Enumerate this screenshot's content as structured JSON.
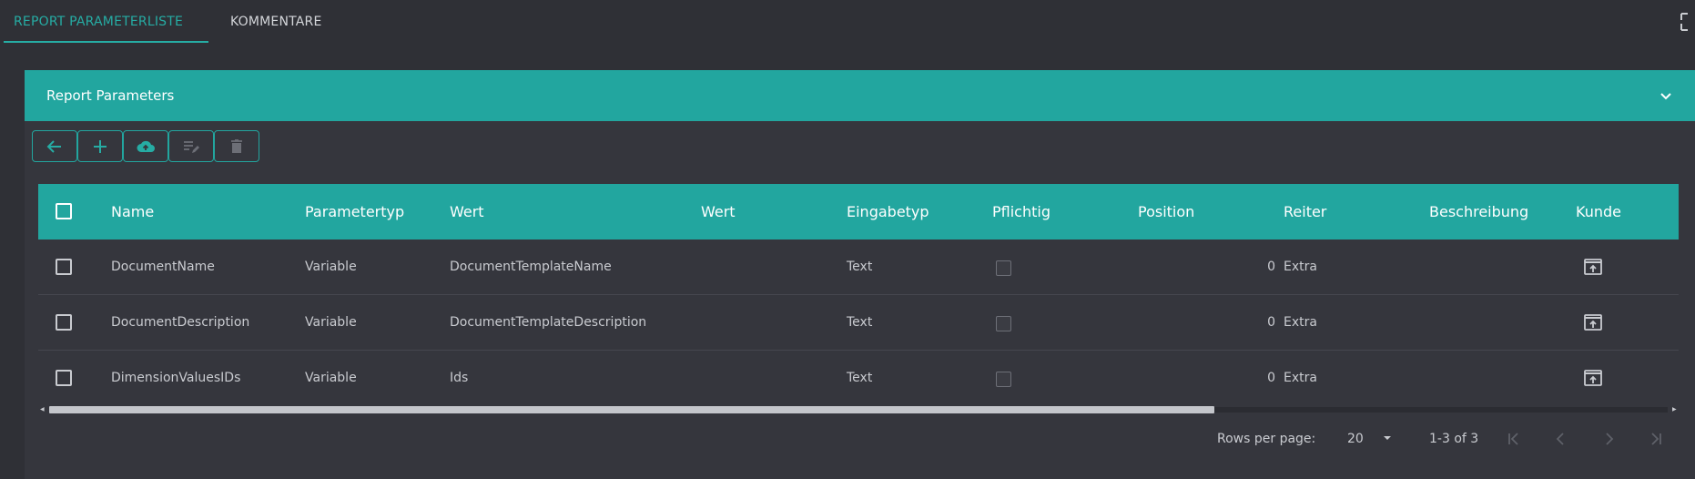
{
  "tabs": [
    {
      "label": "REPORT PARAMETERLISTE",
      "active": true
    },
    {
      "label": "KOMMENTARE",
      "active": false
    }
  ],
  "panel": {
    "title": "Report Parameters"
  },
  "toolbar": {
    "buttons": [
      {
        "icon": "arrow-left-icon",
        "enabled": true
      },
      {
        "icon": "plus-icon",
        "enabled": true
      },
      {
        "icon": "cloud-upload-icon",
        "enabled": true
      },
      {
        "icon": "edit-list-icon",
        "enabled": false
      },
      {
        "icon": "trash-icon",
        "enabled": false
      }
    ]
  },
  "table": {
    "columns": [
      "Name",
      "Parametertyp",
      "Wert",
      "Wert",
      "Eingabetyp",
      "Pflichtig",
      "Position",
      "Reiter",
      "Beschreibung",
      "Kunde"
    ],
    "rows": [
      {
        "name": "DocumentName",
        "type": "Variable",
        "wert1": "DocumentTemplateName",
        "wert2": "",
        "eingabetyp": "Text",
        "pflichtig": false,
        "position": "0",
        "reiter": "Extra",
        "beschreibung": "",
        "kunde_icon": "open-in-icon"
      },
      {
        "name": "DocumentDescription",
        "type": "Variable",
        "wert1": "DocumentTemplateDescription",
        "wert2": "",
        "eingabetyp": "Text",
        "pflichtig": false,
        "position": "0",
        "reiter": "Extra",
        "beschreibung": "",
        "kunde_icon": "open-in-icon"
      },
      {
        "name": "DimensionValuesIDs",
        "type": "Variable",
        "wert1": "Ids",
        "wert2": "",
        "eingabetyp": "Text",
        "pflichtig": false,
        "position": "0",
        "reiter": "Extra",
        "beschreibung": "",
        "kunde_icon": "open-in-icon"
      }
    ]
  },
  "pagination": {
    "rows_per_page_label": "Rows per page:",
    "rows_per_page_value": "20",
    "range": "1-3 of 3"
  },
  "colors": {
    "accent": "#22a69f",
    "background": "#2f3036",
    "panel": "#35363d"
  }
}
